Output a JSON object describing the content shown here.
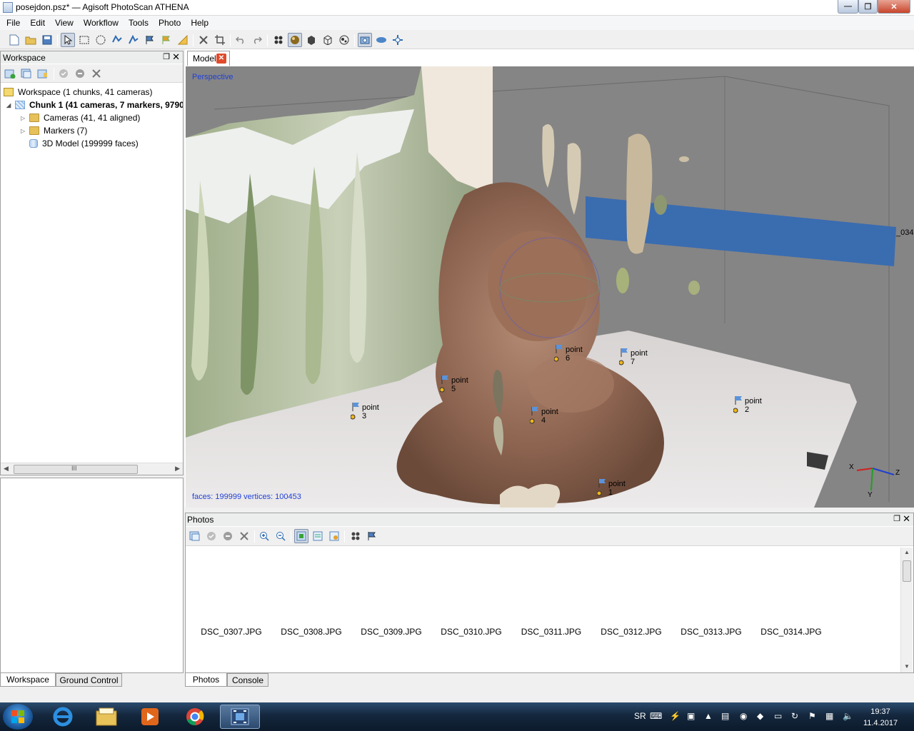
{
  "window": {
    "title": "posejdon.psz* — Agisoft PhotoScan ATHENA",
    "min_glyph": "—",
    "max_glyph": "❐",
    "close_glyph": "✕"
  },
  "menu": [
    "File",
    "Edit",
    "View",
    "Workflow",
    "Tools",
    "Photo",
    "Help"
  ],
  "toolbar_icons": [
    "new-icon",
    "open-icon",
    "save-icon",
    "select-icon",
    "rect-select-icon",
    "circle-select-icon",
    "free-select-icon",
    "move-icon",
    "marker-icon",
    "ruler-icon",
    "delete-icon",
    "crop-icon",
    "undo-icon",
    "redo-icon",
    "point-cloud-icon",
    "shaded-icon",
    "solid-icon",
    "wireframe-icon",
    "texture-icon",
    "cameras-icon",
    "region-icon",
    "reset-view-icon"
  ],
  "workspace": {
    "title": "Workspace",
    "tree": [
      {
        "label": "Workspace (1 chunks, 41 cameras)"
      },
      {
        "label": "Chunk 1 (41 cameras, 7 markers, 9790"
      },
      {
        "label": "Cameras (41, 41 aligned)"
      },
      {
        "label": "Markers (7)"
      },
      {
        "label": "3D Model (199999 faces)"
      }
    ],
    "hscroll_glyph": "III",
    "tabs": [
      "Workspace",
      "Ground Control"
    ]
  },
  "model": {
    "tab_label": "Model",
    "projection": "Perspective",
    "stats": "faces: 199999 vertices: 100453",
    "camera_label": "_034",
    "axes": {
      "x": "X",
      "y": "Y",
      "z": "Z"
    },
    "markers": [
      "point 1",
      "point 2",
      "point 3",
      "point 4",
      "point 5",
      "point 6",
      "point 7"
    ]
  },
  "photos": {
    "title": "Photos",
    "files": [
      "DSC_0307.JPG",
      "DSC_0308.JPG",
      "DSC_0309.JPG",
      "DSC_0310.JPG",
      "DSC_0311.JPG",
      "DSC_0312.JPG",
      "DSC_0313.JPG",
      "DSC_0314.JPG"
    ],
    "tabs": [
      "Photos",
      "Console"
    ]
  },
  "taskbar": {
    "lang": "SR",
    "time": "19:37",
    "date": "11.4.2017",
    "apps": [
      "explorer-ie-icon",
      "file-manager-icon",
      "media-player-icon",
      "chrome-icon",
      "video-icon"
    ]
  },
  "colors": {
    "accent": "#1f3fd8",
    "selected_camera": "#3a6cb0",
    "close_red": "#c7452c"
  }
}
